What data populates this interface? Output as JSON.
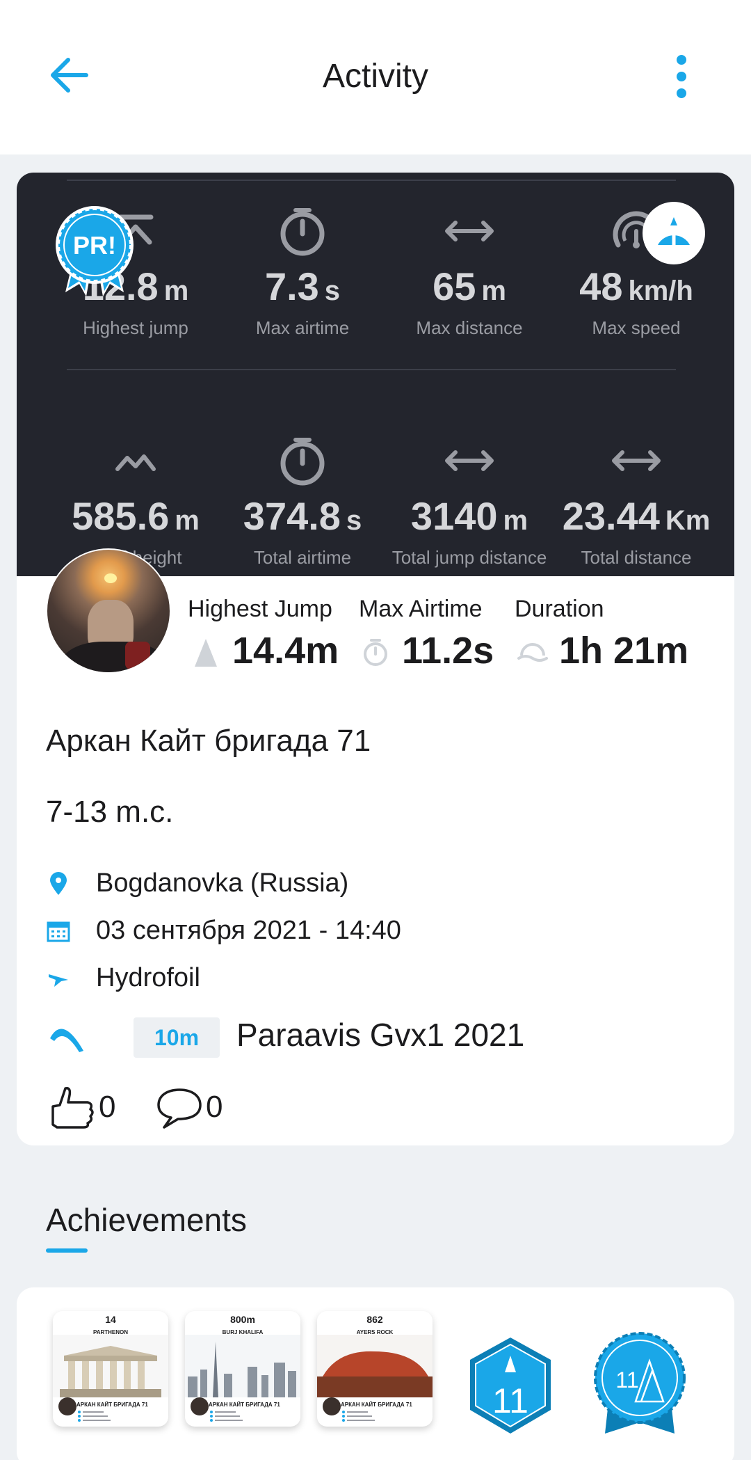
{
  "appbar": {
    "title": "Activity"
  },
  "stats_top": [
    {
      "value": "12.8",
      "unit": "m",
      "label": "Highest jump",
      "icon": "peak-icon"
    },
    {
      "value": "7.3",
      "unit": "s",
      "label": "Max airtime",
      "icon": "stopwatch-icon"
    },
    {
      "value": "65",
      "unit": "m",
      "label": "Max distance",
      "icon": "arrows-horizontal-icon"
    },
    {
      "value": "48",
      "unit": "km/h",
      "label": "Max speed",
      "icon": "speedometer-icon"
    }
  ],
  "stats_bottom": [
    {
      "value": "585.6",
      "unit": "m",
      "label": "Total height",
      "icon": "double-peak-icon"
    },
    {
      "value": "374.8",
      "unit": "s",
      "label": "Total airtime",
      "icon": "stopwatch-icon"
    },
    {
      "value": "3140",
      "unit": "m",
      "label": "Total jump distance",
      "icon": "arrows-horizontal-icon"
    },
    {
      "value": "23.44",
      "unit": "Km",
      "label": "Total distance",
      "icon": "arrows-horizontal-icon"
    }
  ],
  "pr_badge": "PR!",
  "summary": {
    "highest_jump_label": "Highest Jump",
    "highest_jump_value": "14.4m",
    "max_airtime_label": "Max Airtime",
    "max_airtime_value": "11.2s",
    "duration_label": "Duration",
    "duration_value": "1h 21m"
  },
  "session": {
    "name": "Аркан Кайт бригада 71",
    "wind": "7-13 m.c.",
    "location": "Bogdanovka (Russia)",
    "datetime": "03 сентября 2021 - 14:40",
    "sport": "Hydrofoil",
    "kite_size": "10m",
    "kite_name": "Paraavis Gvx1 2021"
  },
  "social": {
    "likes": "0",
    "comments": "0"
  },
  "achievements": {
    "title": "Achievements",
    "items": [
      {
        "number": "14",
        "subtitle": "PARTHENON",
        "caption": "АРКАН КАЙТ БРИГАДА 71"
      },
      {
        "number": "800m",
        "subtitle": "BURJ KHALIFA",
        "caption": "АРКАН КАЙТ БРИГАДА 71"
      },
      {
        "number": "862",
        "subtitle": "AYERS ROCK",
        "caption": "АРКАН КАЙТ БРИГАДА 71"
      }
    ],
    "badge_hex_number": "11",
    "badge_round_number": "11"
  },
  "colors": {
    "accent": "#1aa7e8",
    "panel": "#23252d",
    "background": "#eef1f4"
  }
}
